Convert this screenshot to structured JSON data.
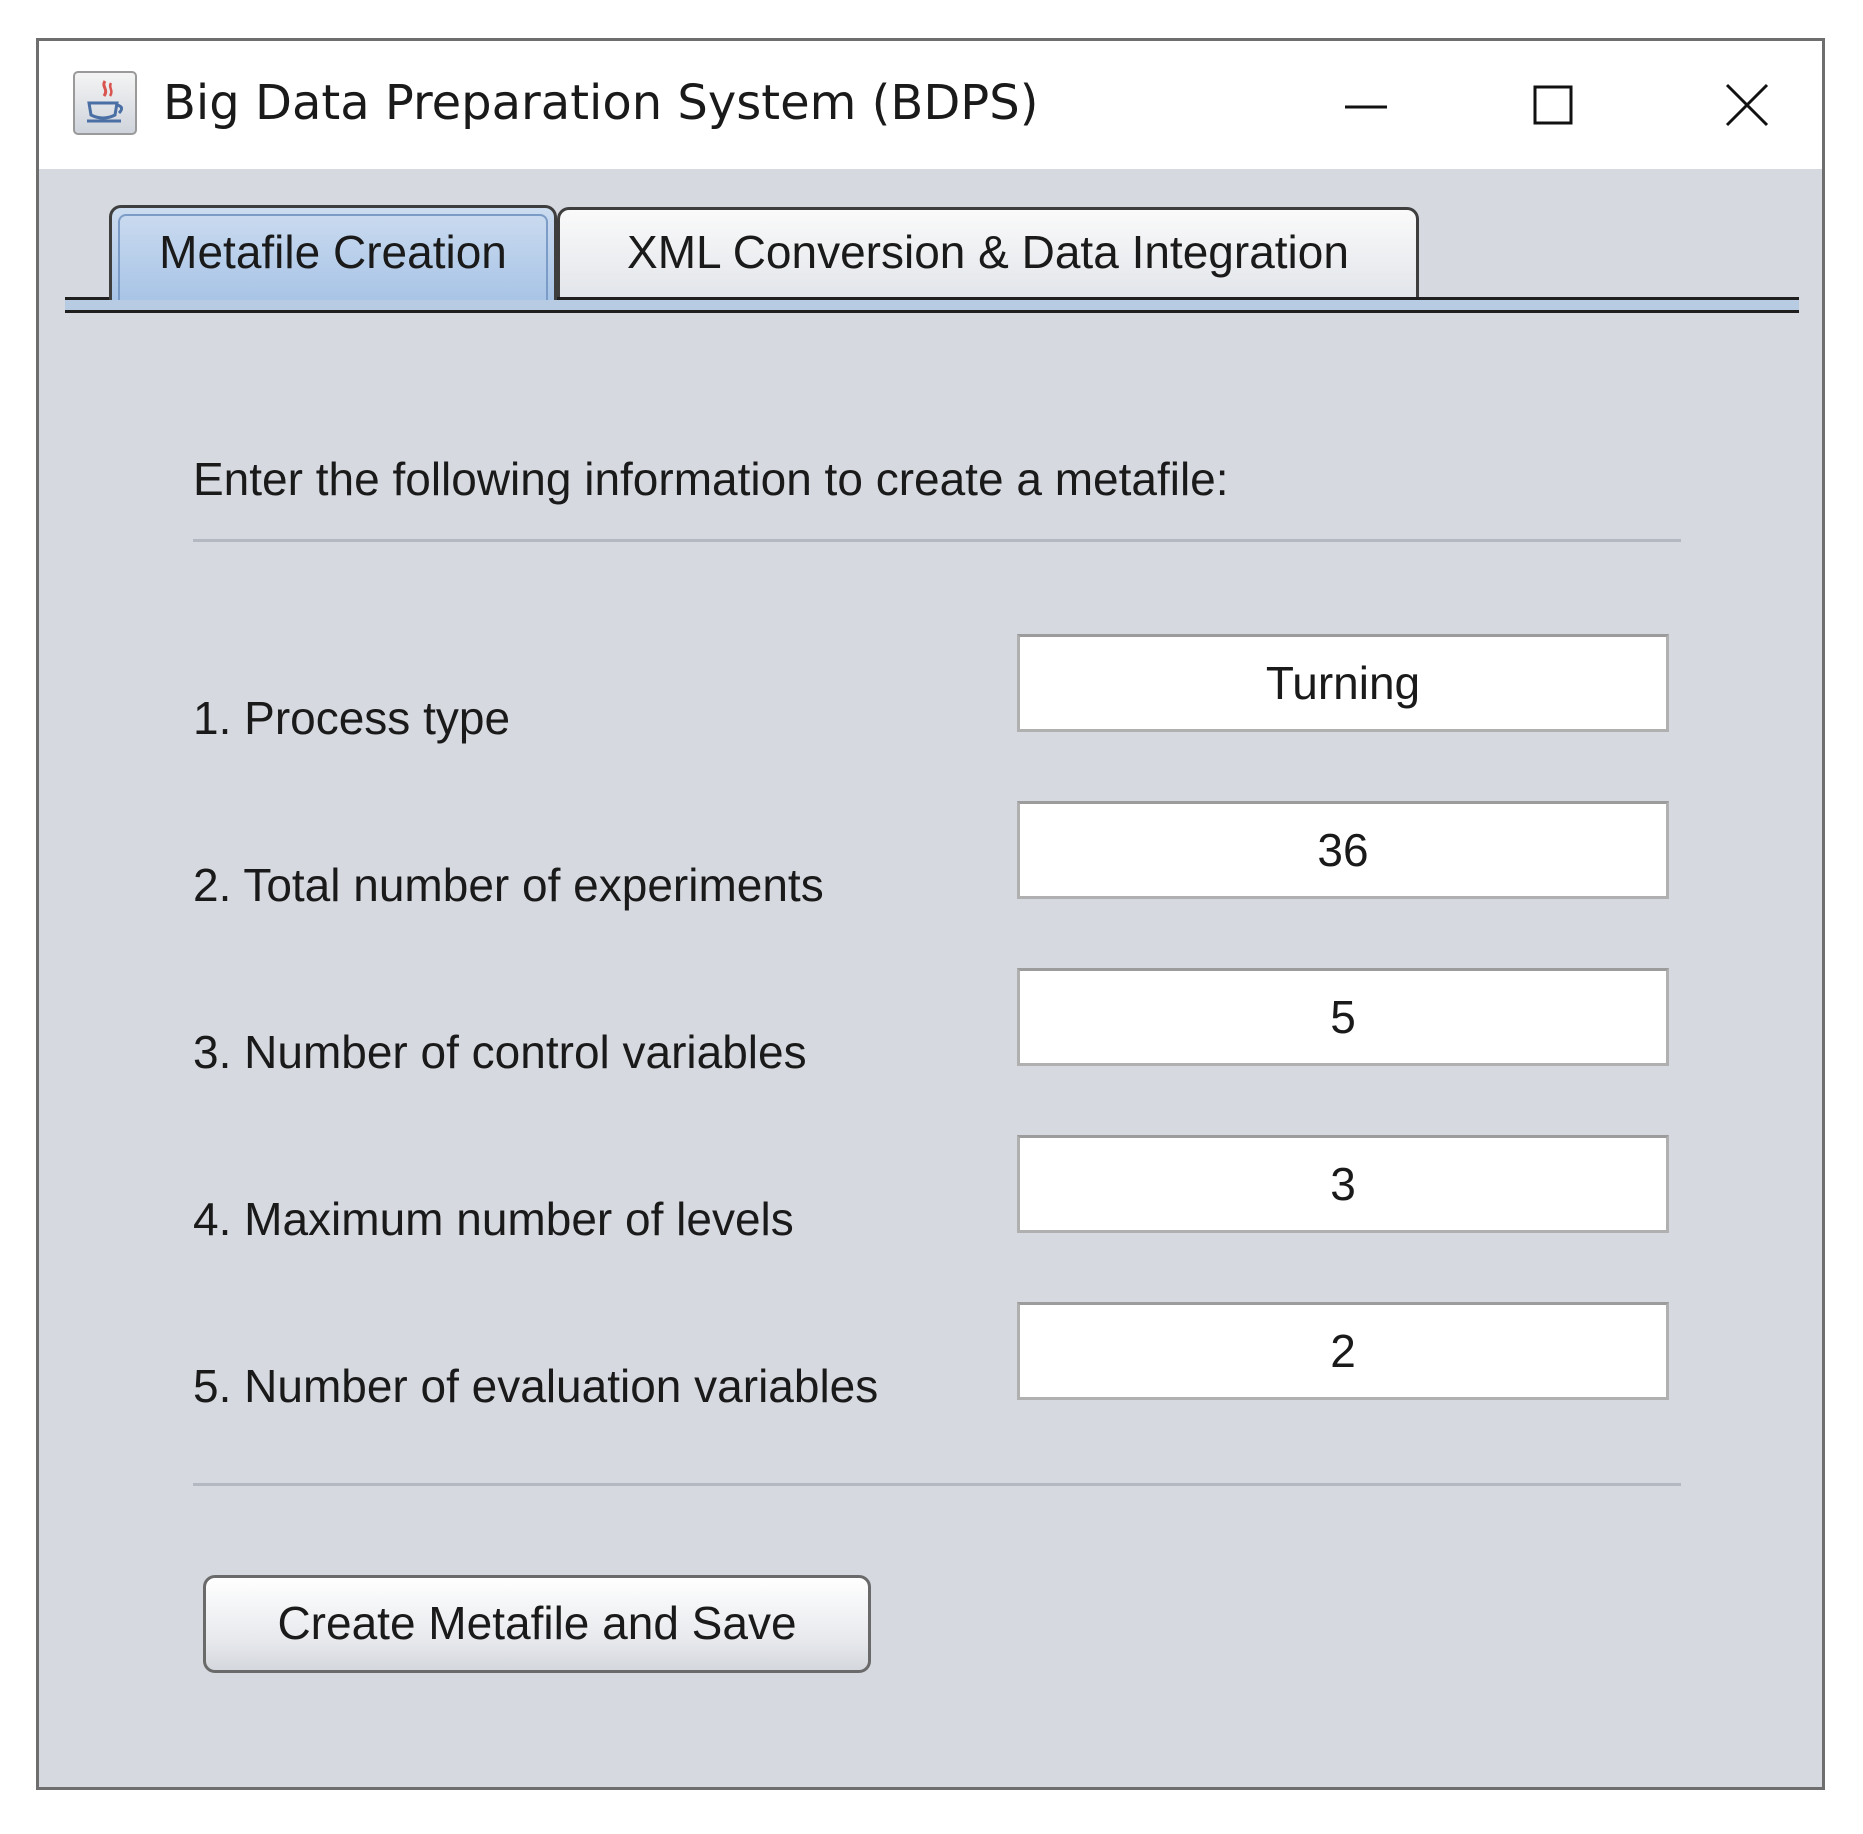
{
  "window": {
    "title": "Big Data Preparation System (BDPS)",
    "icon": "java-coffee-cup-icon",
    "controls": [
      "minimize-icon",
      "maximize-icon",
      "close-icon"
    ]
  },
  "tabs": [
    {
      "label": "Metafile Creation",
      "active": true
    },
    {
      "label": "XML Conversion & Data Integration",
      "active": false
    }
  ],
  "form": {
    "intro": "Enter the following information to create a metafile:",
    "rows": [
      {
        "label": "1. Process type",
        "value": "Turning"
      },
      {
        "label": "2. Total number of experiments",
        "value": "36"
      },
      {
        "label": "3. Number of control variables",
        "value": "5"
      },
      {
        "label": "4. Maximum number of levels",
        "value": "3"
      },
      {
        "label": "5. Number of evaluation variables",
        "value": "2"
      }
    ],
    "submit_label": "Create Metafile and Save"
  },
  "colors": {
    "background": "#d6d9e0",
    "active_tab": "#a8c4e6"
  }
}
